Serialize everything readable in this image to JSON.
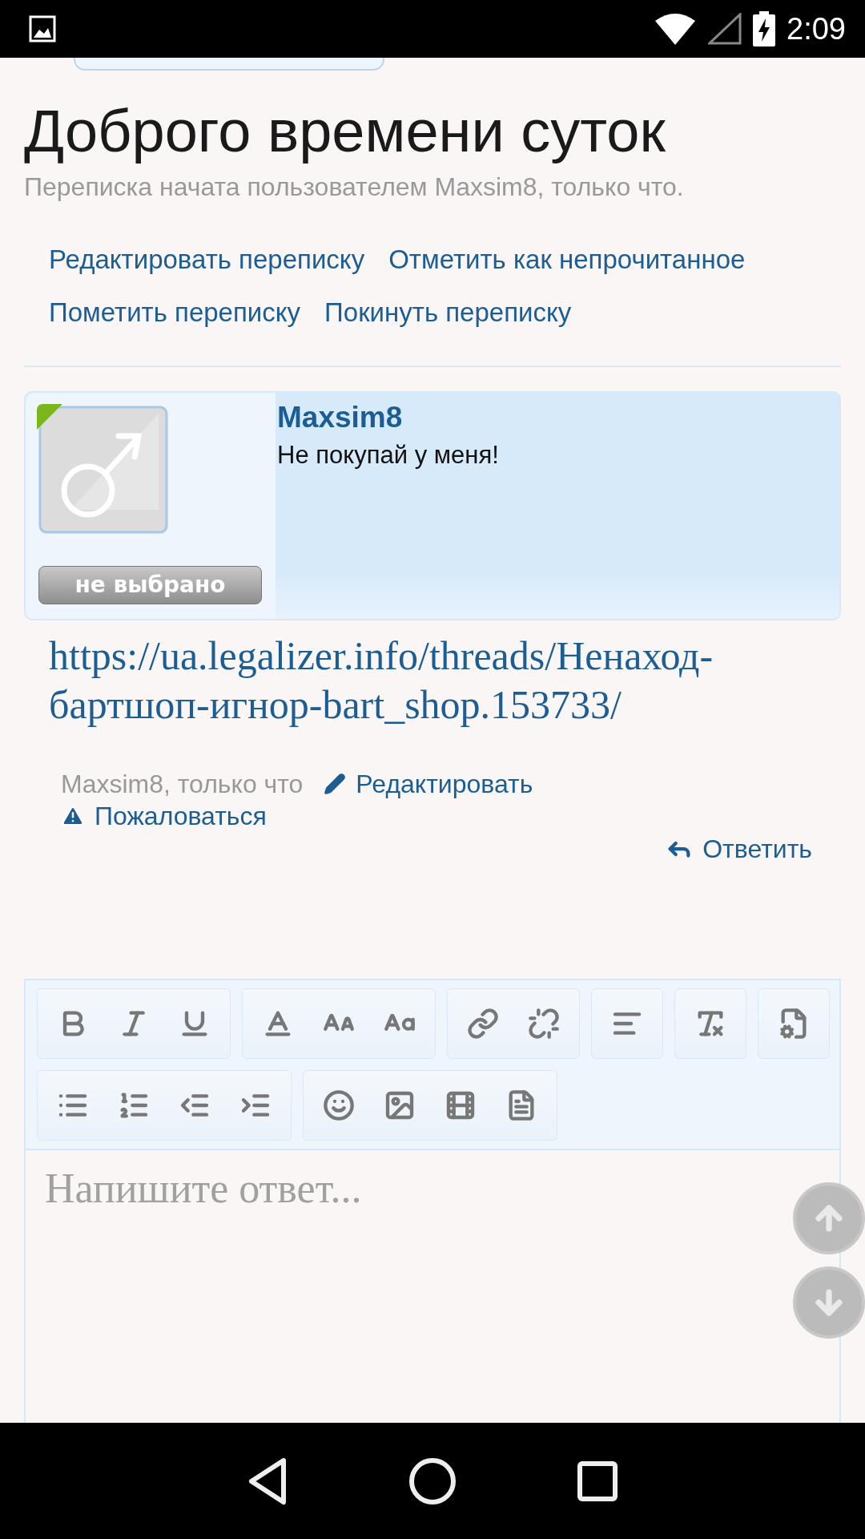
{
  "status_bar": {
    "time": "2:09"
  },
  "thread": {
    "title": "Доброго времени суток",
    "subtitle": "Переписка начата пользователем Maxsim8, только что.",
    "actions": [
      {
        "label": "Редактировать переписку"
      },
      {
        "label": "Отметить как непрочитанное"
      },
      {
        "label": "Пометить переписку"
      },
      {
        "label": "Покинуть переписку"
      }
    ]
  },
  "message": {
    "author": "Maxsim8",
    "avatar_badge": "не выбрано",
    "text": "Не покупай у меня!",
    "link": "https://ua.legalizer.info/threads/Ненаход-бартшоп-игнор-bart_shop.153733/",
    "meta": "Maxsim8, только что",
    "edit": "Редактировать",
    "report": "Пожаловаться",
    "reply": "Ответить"
  },
  "editor": {
    "toolbar": [
      [
        {
          "kind": "bold"
        },
        {
          "kind": "italic"
        },
        {
          "kind": "underline"
        }
      ],
      [
        {
          "kind": "text-color"
        },
        {
          "kind": "font-size"
        },
        {
          "kind": "font-family"
        }
      ],
      [
        {
          "kind": "link"
        },
        {
          "kind": "unlink"
        }
      ],
      [
        {
          "kind": "align"
        }
      ],
      [
        {
          "kind": "remove-format"
        }
      ],
      [
        {
          "kind": "settings"
        }
      ],
      [
        {
          "kind": "bullet-list"
        },
        {
          "kind": "number-list"
        },
        {
          "kind": "outdent"
        },
        {
          "kind": "indent"
        }
      ],
      [
        {
          "kind": "smile"
        },
        {
          "kind": "image"
        },
        {
          "kind": "media"
        },
        {
          "kind": "template"
        }
      ]
    ],
    "placeholder": "Напишите ответ..."
  }
}
